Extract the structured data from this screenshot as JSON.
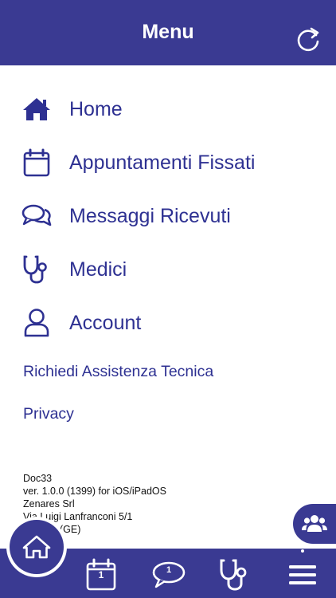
{
  "header": {
    "title": "Menu"
  },
  "menu": {
    "items": [
      {
        "label": "Home"
      },
      {
        "label": "Appuntamenti Fissati"
      },
      {
        "label": "Messaggi Ricevuti"
      },
      {
        "label": "Medici"
      },
      {
        "label": "Account"
      }
    ],
    "support_link": "Richiedi Assistenza Tecnica",
    "privacy_link": "Privacy"
  },
  "app_info": {
    "name": "Doc33",
    "version": "ver. 1.0.0 (1399) for iOS/iPadOS",
    "company": "Zenares Srl",
    "address": "Via Luigi Lanfranconi 5/1",
    "city": "(GE)"
  },
  "tabbar": {
    "calendar_badge": "1",
    "messages_badge": "1"
  },
  "colors": {
    "brand": "#3a3a92",
    "text": "#2e3192"
  },
  "icons": {
    "refresh": "refresh-icon",
    "home": "home-icon",
    "calendar": "calendar-icon",
    "messages": "chat-bubbles-icon",
    "doctors": "stethoscope-icon",
    "account": "user-icon",
    "group": "group-icon",
    "menu": "hamburger-icon"
  }
}
